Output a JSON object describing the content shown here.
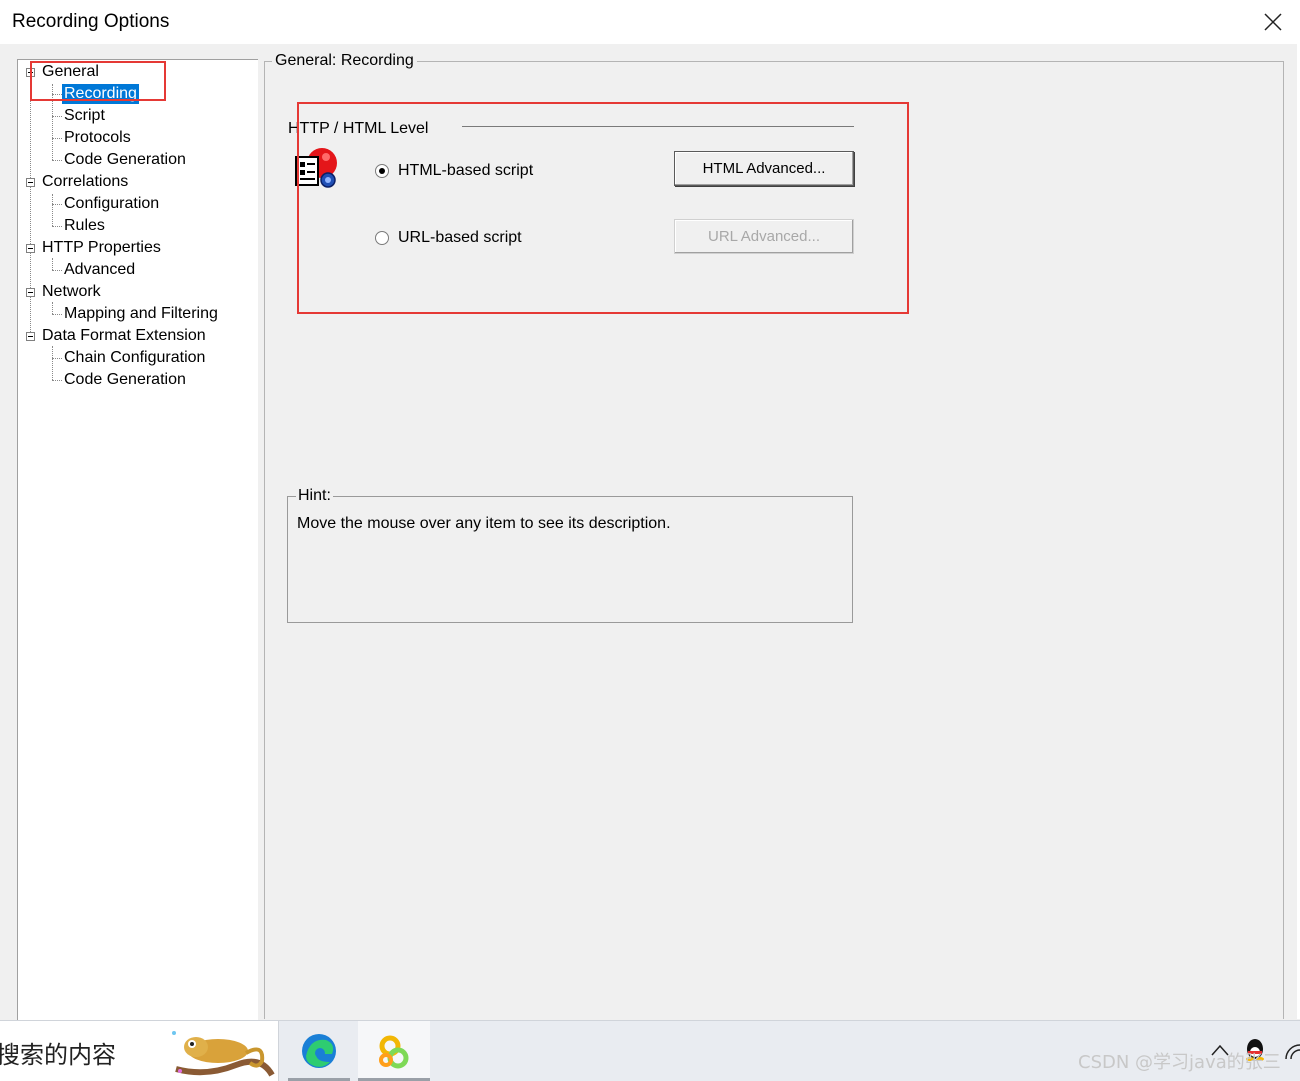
{
  "window": {
    "title": "Recording Options"
  },
  "tree": {
    "general": "General",
    "recording": "Recording",
    "script": "Script",
    "protocols": "Protocols",
    "code_generation": "Code Generation",
    "correlations": "Correlations",
    "configuration": "Configuration",
    "rules": "Rules",
    "http_properties": "HTTP Properties",
    "advanced": "Advanced",
    "network": "Network",
    "mapping_filtering": "Mapping and Filtering",
    "data_format_extension": "Data Format Extension",
    "chain_configuration": "Chain Configuration",
    "code_generation_2": "Code Generation",
    "selected_item": "Recording"
  },
  "panel": {
    "caption": "General: Recording",
    "group_title": "HTTP / HTML Level",
    "html_option": "HTML-based script",
    "url_option": "URL-based script",
    "selected_option": "HTML-based script",
    "html_advanced_button": "HTML Advanced...",
    "url_advanced_button": "URL Advanced...",
    "hint_caption": "Hint:",
    "hint_text": "Move the mouse over any item to see its description."
  },
  "taskbar": {
    "search_text": "搜索的内容",
    "watermark": "CSDN @学习java的张三"
  },
  "colors": {
    "selection": "#0078d7",
    "annotation_red": "#e53935"
  },
  "icons": [
    "close-icon",
    "recording-script-icon",
    "chameleon-icon",
    "edge-icon",
    "app-icon"
  ]
}
